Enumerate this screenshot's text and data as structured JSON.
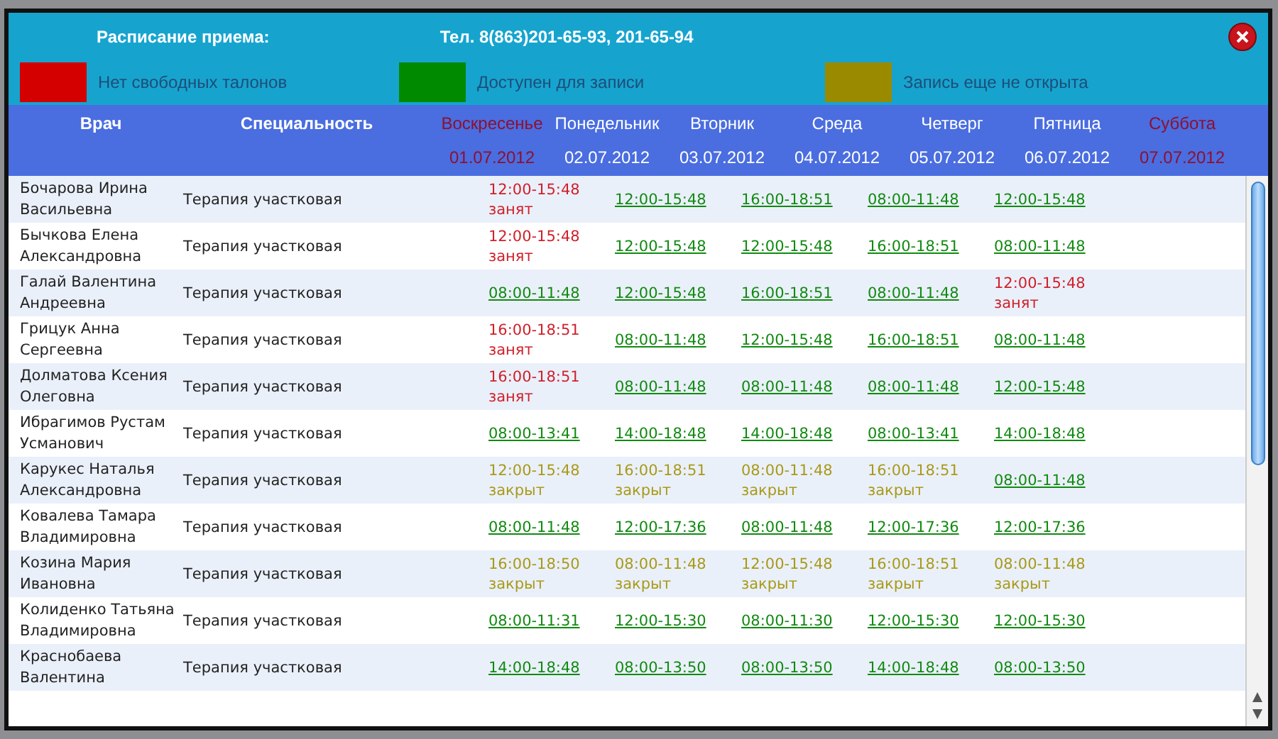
{
  "header": {
    "title": "Расписание приема:",
    "phone": "Тел. 8(863)201-65-93, 201-65-94"
  },
  "legend": [
    {
      "label": "Нет свободных талонов",
      "color": "#d40000"
    },
    {
      "label": "Доступен для записи",
      "color": "#008a00"
    },
    {
      "label": "Запись еще не открыта",
      "color": "#9a8a00"
    }
  ],
  "columns": {
    "doctor": "Врач",
    "specialty": "Специальность"
  },
  "days": [
    {
      "name": "Воскресенье",
      "date": "01.07.2012",
      "weekend": true
    },
    {
      "name": "Понедельник",
      "date": "02.07.2012",
      "weekend": false
    },
    {
      "name": "Вторник",
      "date": "03.07.2012",
      "weekend": false
    },
    {
      "name": "Среда",
      "date": "04.07.2012",
      "weekend": false
    },
    {
      "name": "Четверг",
      "date": "05.07.2012",
      "weekend": false
    },
    {
      "name": "Пятница",
      "date": "06.07.2012",
      "weekend": false
    },
    {
      "name": "Суббота",
      "date": "07.07.2012",
      "weekend": true
    }
  ],
  "rows": [
    {
      "doctor": "Бочарова Ирина Васильевна",
      "specialty": "Терапия участковая",
      "slots": [
        {
          "time": "12:00-15:48",
          "kind": "busy",
          "note": "занят"
        },
        {
          "time": "12:00-15:48",
          "kind": "open"
        },
        {
          "time": "16:00-18:51",
          "kind": "open"
        },
        {
          "time": "08:00-11:48",
          "kind": "open"
        },
        {
          "time": "12:00-15:48",
          "kind": "open"
        }
      ]
    },
    {
      "doctor": "Бычкова Елена Александровна",
      "specialty": "Терапия участковая",
      "slots": [
        {
          "time": "12:00-15:48",
          "kind": "busy",
          "note": "занят"
        },
        {
          "time": "12:00-15:48",
          "kind": "open"
        },
        {
          "time": "12:00-15:48",
          "kind": "open"
        },
        {
          "time": "16:00-18:51",
          "kind": "open"
        },
        {
          "time": "08:00-11:48",
          "kind": "open"
        }
      ]
    },
    {
      "doctor": "Галай Валентина Андреевна",
      "specialty": "Терапия участковая",
      "slots": [
        {
          "time": "08:00-11:48",
          "kind": "open"
        },
        {
          "time": "12:00-15:48",
          "kind": "open"
        },
        {
          "time": "16:00-18:51",
          "kind": "open"
        },
        {
          "time": "08:00-11:48",
          "kind": "open"
        },
        {
          "time": "12:00-15:48",
          "kind": "busy",
          "note": "занят"
        }
      ]
    },
    {
      "doctor": "Грицук Анна Сергеевна",
      "specialty": "Терапия участковая",
      "slots": [
        {
          "time": "16:00-18:51",
          "kind": "busy",
          "note": "занят"
        },
        {
          "time": "08:00-11:48",
          "kind": "open"
        },
        {
          "time": "12:00-15:48",
          "kind": "open"
        },
        {
          "time": "16:00-18:51",
          "kind": "open"
        },
        {
          "time": "08:00-11:48",
          "kind": "open"
        }
      ]
    },
    {
      "doctor": "Долматова Ксения Олеговна",
      "specialty": "Терапия участковая",
      "slots": [
        {
          "time": "16:00-18:51",
          "kind": "busy",
          "note": "занят"
        },
        {
          "time": "08:00-11:48",
          "kind": "open"
        },
        {
          "time": "08:00-11:48",
          "kind": "open"
        },
        {
          "time": "08:00-11:48",
          "kind": "open"
        },
        {
          "time": "12:00-15:48",
          "kind": "open"
        }
      ]
    },
    {
      "doctor": "Ибрагимов Рустам Усманович",
      "specialty": "Терапия участковая",
      "slots": [
        {
          "time": "08:00-13:41",
          "kind": "open"
        },
        {
          "time": "14:00-18:48",
          "kind": "open"
        },
        {
          "time": "14:00-18:48",
          "kind": "open"
        },
        {
          "time": "08:00-13:41",
          "kind": "open"
        },
        {
          "time": "14:00-18:48",
          "kind": "open"
        }
      ]
    },
    {
      "doctor": "Карукес Наталья Александровна",
      "specialty": "Терапия участковая",
      "slots": [
        {
          "time": "12:00-15:48",
          "kind": "closed",
          "note": "закрыт"
        },
        {
          "time": "16:00-18:51",
          "kind": "closed",
          "note": "закрыт"
        },
        {
          "time": "08:00-11:48",
          "kind": "closed",
          "note": "закрыт"
        },
        {
          "time": "16:00-18:51",
          "kind": "closed",
          "note": "закрыт"
        },
        {
          "time": "08:00-11:48",
          "kind": "open"
        }
      ]
    },
    {
      "doctor": "Ковалева Тамара Владимировна",
      "specialty": "Терапия участковая",
      "slots": [
        {
          "time": "08:00-11:48",
          "kind": "open"
        },
        {
          "time": "12:00-17:36",
          "kind": "open"
        },
        {
          "time": "08:00-11:48",
          "kind": "open"
        },
        {
          "time": "12:00-17:36",
          "kind": "open"
        },
        {
          "time": "12:00-17:36",
          "kind": "open"
        }
      ]
    },
    {
      "doctor": "Козина Мария Ивановна",
      "specialty": "Терапия участковая",
      "slots": [
        {
          "time": "16:00-18:50",
          "kind": "closed",
          "note": "закрыт"
        },
        {
          "time": "08:00-11:48",
          "kind": "closed",
          "note": "закрыт"
        },
        {
          "time": "12:00-15:48",
          "kind": "closed",
          "note": "закрыт"
        },
        {
          "time": "16:00-18:51",
          "kind": "closed",
          "note": "закрыт"
        },
        {
          "time": "08:00-11:48",
          "kind": "closed",
          "note": "закрыт"
        }
      ]
    },
    {
      "doctor": "Колиденко Татьяна Владимировна",
      "specialty": "Терапия участковая",
      "slots": [
        {
          "time": "08:00-11:31",
          "kind": "open"
        },
        {
          "time": "12:00-15:30",
          "kind": "open"
        },
        {
          "time": "08:00-11:30",
          "kind": "open"
        },
        {
          "time": "12:00-15:30",
          "kind": "open"
        },
        {
          "time": "12:00-15:30",
          "kind": "open"
        }
      ]
    },
    {
      "doctor": "Краснобаева Валентина",
      "specialty": "Терапия участковая",
      "slots": [
        {
          "time": "14:00-18:48",
          "kind": "open"
        },
        {
          "time": "08:00-13:50",
          "kind": "open"
        },
        {
          "time": "08:00-13:50",
          "kind": "open"
        },
        {
          "time": "14:00-18:48",
          "kind": "open"
        },
        {
          "time": "08:00-13:50",
          "kind": "open"
        }
      ]
    }
  ]
}
